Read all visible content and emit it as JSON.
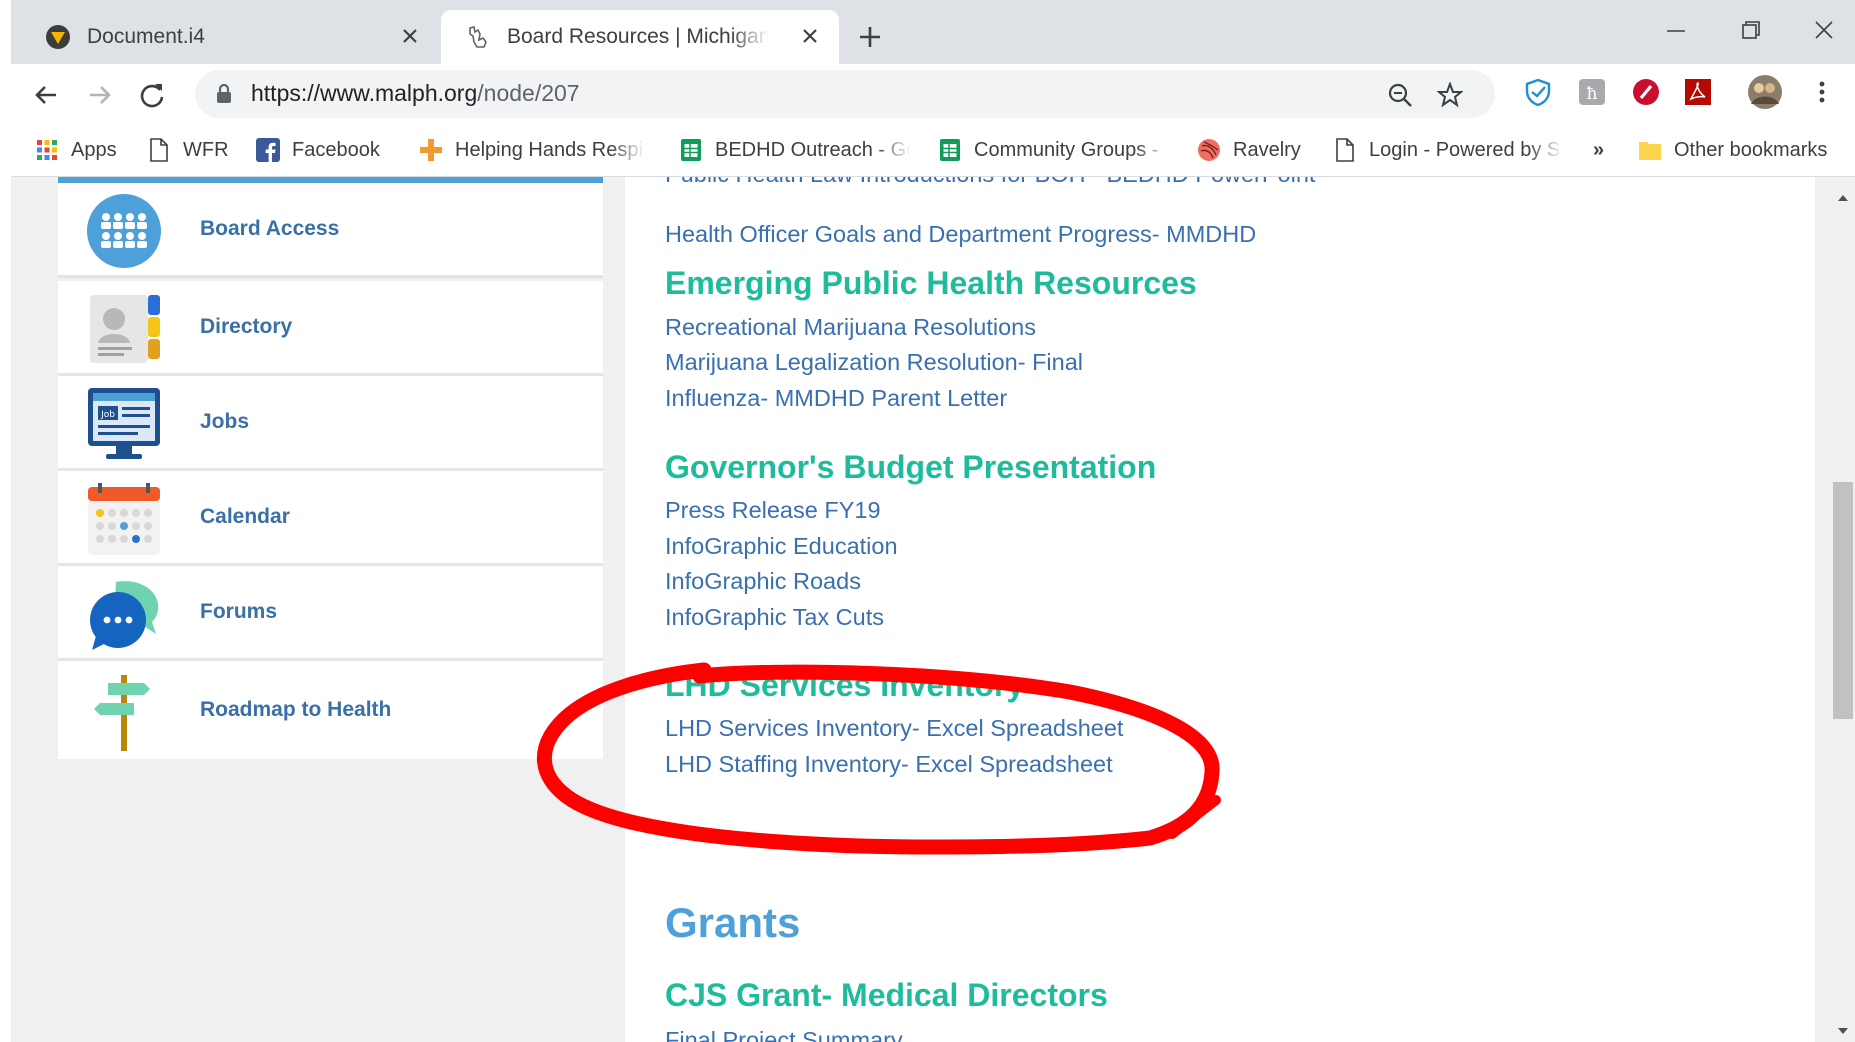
{
  "tabs": [
    {
      "title": "Document.i4"
    },
    {
      "title": "Board Resources | Michigan Association"
    }
  ],
  "omnibox": {
    "url_host": "https://www.malph.org",
    "url_path": "/node/207"
  },
  "bookmarks": {
    "items": [
      {
        "label": "Apps"
      },
      {
        "label": "WFR"
      },
      {
        "label": "Facebook"
      },
      {
        "label": "Helping Hands Respite"
      },
      {
        "label": "BEDHD Outreach - Google"
      },
      {
        "label": "Community Groups -"
      },
      {
        "label": "Ravelry"
      },
      {
        "label": "Login - Powered by S"
      }
    ],
    "overflow": "»",
    "other": "Other bookmarks"
  },
  "sidebar": {
    "items": [
      {
        "label": "Board Access"
      },
      {
        "label": "Directory"
      },
      {
        "label": "Jobs"
      },
      {
        "label": "Calendar"
      },
      {
        "label": "Forums"
      },
      {
        "label": "Roadmap to Health"
      }
    ]
  },
  "content": {
    "partial_link_top": "Public Health Law Introductions for BOH - BEDHD PowerPoint",
    "health_officer_link": "Health Officer Goals and Department Progress- MMDHD",
    "sections": [
      {
        "heading": "Emerging Public Health Resources",
        "links": [
          "Recreational Marijuana Resolutions",
          "Marijuana Legalization Resolution- Final",
          "Influenza- MMDHD Parent Letter"
        ]
      },
      {
        "heading": "Governor's Budget Presentation",
        "links": [
          "Press Release FY19",
          "InfoGraphic Education",
          "InfoGraphic Roads",
          "InfoGraphic Tax Cuts"
        ]
      },
      {
        "heading": "LHD Services Inventory",
        "links": [
          "LHD Services Inventory- Excel Spreadsheet",
          "LHD Staffing Inventory- Excel Spreadsheet"
        ]
      }
    ],
    "grants_heading": "Grants",
    "cjs_heading": "CJS Grant- Medical Directors",
    "cjs_partial_link": "Final Project Summary"
  },
  "colors": {
    "link": "#3a6fb0",
    "section_heading": "#1ebc9c",
    "grants_heading": "#4ea0d8",
    "annotation_circle": "#ff0000"
  }
}
